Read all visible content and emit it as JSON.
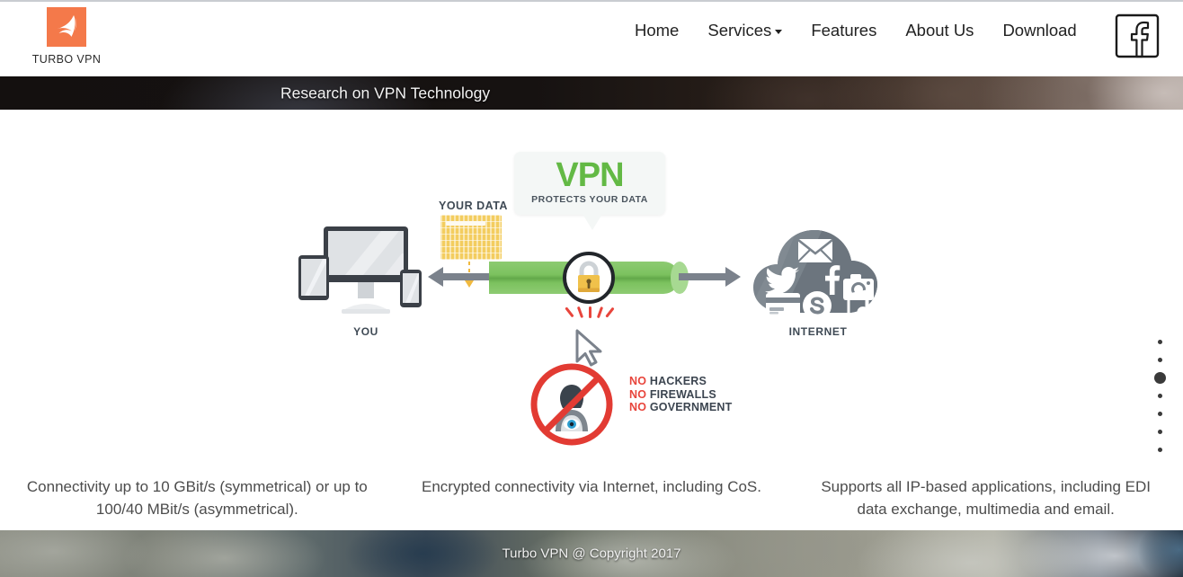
{
  "brand": {
    "name": "TURBO VPN",
    "logo_icon": "turbo-bird-logo-icon",
    "logo_color": "#f4794a"
  },
  "nav": {
    "items": [
      {
        "label": "Home",
        "has_caret": false
      },
      {
        "label": "Services",
        "has_caret": true
      },
      {
        "label": "Features",
        "has_caret": false
      },
      {
        "label": "About Us",
        "has_caret": false
      },
      {
        "label": "Download",
        "has_caret": false
      }
    ],
    "social": {
      "icon": "facebook-icon",
      "label": "Facebook"
    }
  },
  "banner": {
    "title": "Research on VPN Technology"
  },
  "slide": {
    "your_data_label": "YOUR DATA",
    "bubble_title": "VPN",
    "bubble_subtitle": "PROTECTS YOUR DATA",
    "you_label": "YOU",
    "internet_label": "INTERNET",
    "lock_icon": "padlock-icon",
    "blocked": {
      "line1_prefix": "NO",
      "line1": "HACKERS",
      "line2_prefix": "NO",
      "line2": "FIREWALLS",
      "line3_prefix": "NO",
      "line3": "GOVERNMENT"
    },
    "cloud_icons": [
      "envelope-icon",
      "twitter-icon",
      "facebook-f-icon",
      "camera-icon",
      "credit-card-icon",
      "skype-icon",
      "music-note-icon"
    ],
    "accent_green": "#63b945",
    "accent_red": "#e8453c"
  },
  "carousel": {
    "total_slides": 7,
    "active_index": 2
  },
  "features": [
    {
      "text": "Connectivity up to 10 GBit/s (symmetrical) or up to 100/40 MBit/s (asymmetrical)."
    },
    {
      "text": "Encrypted connectivity via Internet, including CoS."
    },
    {
      "text": "Supports all IP-based applications, including EDI data exchange, multimedia and email."
    }
  ],
  "footer": {
    "copyright": "Turbo VPN @ Copyright 2017"
  }
}
